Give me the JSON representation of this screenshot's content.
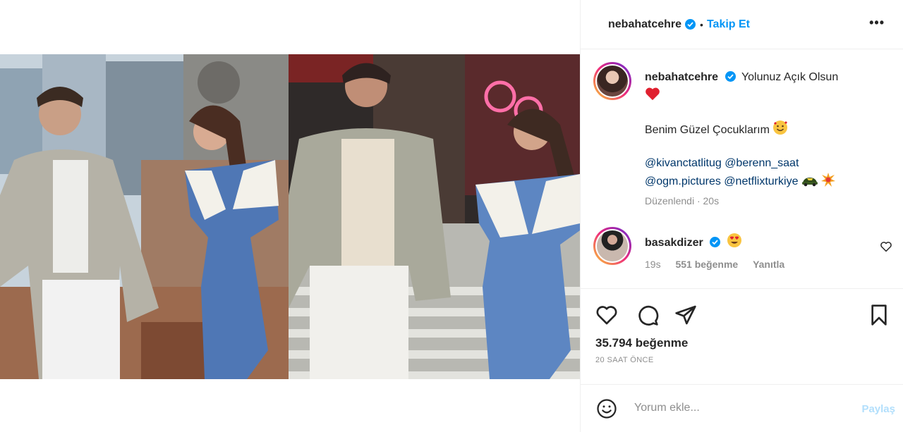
{
  "post": {
    "author": "nebahatcehre",
    "follow_label": "Takip Et",
    "more_icon": "more-horizontal-icon",
    "more_glyph": "•••",
    "separator": "•"
  },
  "caption": {
    "username": "nebahatcehre",
    "line1": "Yolunuz Açık Olsun",
    "line2": "Benim Güzel Çocuklarım",
    "mentions_line1": [
      "@kivanctatlitug",
      "@berenn_saat"
    ],
    "mentions_line2": [
      "@ogm.pictures",
      "@netflixturkiye"
    ],
    "edited": "Düzenlendi",
    "edited_sep": " · ",
    "time": "20s"
  },
  "comment": {
    "username": "basakdizer",
    "time": "19s",
    "likes": "551 beğenme",
    "reply": "Yanıtla"
  },
  "stats": {
    "likes": "35.794 beğenme",
    "posted": "20 SAAT ÖNCE"
  },
  "composer": {
    "placeholder": "Yorum ekle...",
    "post_label": "Paylaş"
  },
  "colors": {
    "accent": "#0095f6",
    "verified": "#0095f6",
    "post_disabled": "#b2dffc",
    "heart_red": "#ed4956"
  }
}
